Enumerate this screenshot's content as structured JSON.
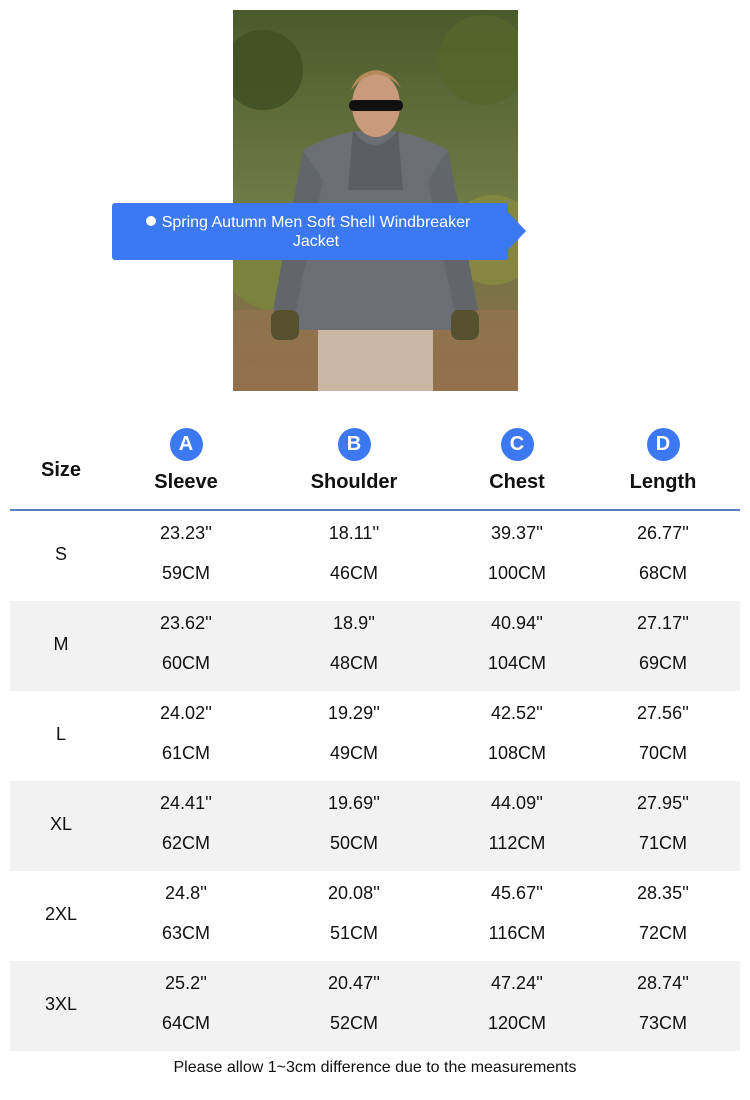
{
  "banner": {
    "title": "Spring Autumn Men Soft Shell Windbreaker Jacket"
  },
  "table": {
    "size_header": "Size",
    "columns": [
      {
        "badge": "A",
        "label": "Sleeve"
      },
      {
        "badge": "B",
        "label": "Shoulder"
      },
      {
        "badge": "C",
        "label": "Chest"
      },
      {
        "badge": "D",
        "label": "Length"
      }
    ],
    "rows": [
      {
        "size": "S",
        "inches": [
          "23.23''",
          "18.11''",
          "39.37''",
          "26.77''"
        ],
        "cm": [
          "59CM",
          "46CM",
          "100CM",
          "68CM"
        ]
      },
      {
        "size": "M",
        "inches": [
          "23.62''",
          "18.9''",
          "40.94''",
          "27.17''"
        ],
        "cm": [
          "60CM",
          "48CM",
          "104CM",
          "69CM"
        ]
      },
      {
        "size": "L",
        "inches": [
          "24.02''",
          "19.29''",
          "42.52''",
          "27.56''"
        ],
        "cm": [
          "61CM",
          "49CM",
          "108CM",
          "70CM"
        ]
      },
      {
        "size": "XL",
        "inches": [
          "24.41''",
          "19.69''",
          "44.09''",
          "27.95''"
        ],
        "cm": [
          "62CM",
          "50CM",
          "112CM",
          "71CM"
        ]
      },
      {
        "size": "2XL",
        "inches": [
          "24.8''",
          "20.08''",
          "45.67''",
          "28.35''"
        ],
        "cm": [
          "63CM",
          "51CM",
          "116CM",
          "72CM"
        ]
      },
      {
        "size": "3XL",
        "inches": [
          "25.2''",
          "20.47''",
          "47.24''",
          "28.74''"
        ],
        "cm": [
          "64CM",
          "52CM",
          "120CM",
          "73CM"
        ]
      }
    ]
  },
  "note": "Please allow 1~3cm difference due to the measurements",
  "colors": {
    "accent": "#3b78f1",
    "divider": "#5b7fc4",
    "row_shade": "#f2f2f2"
  }
}
